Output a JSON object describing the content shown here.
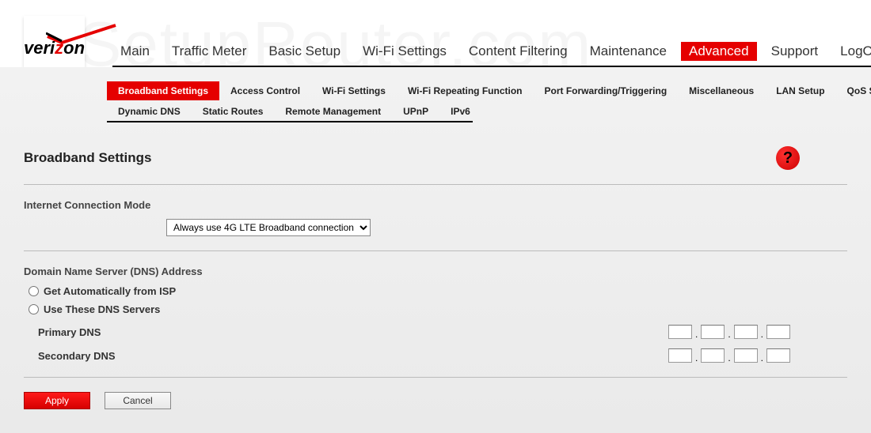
{
  "watermark": "SetupRouter.com",
  "logo": {
    "text_prefix": "veri",
    "text_accent": "z",
    "text_suffix": "on"
  },
  "top_nav": {
    "items": [
      {
        "label": "Main"
      },
      {
        "label": "Traffic Meter"
      },
      {
        "label": "Basic Setup"
      },
      {
        "label": "Wi-Fi Settings"
      },
      {
        "label": "Content Filtering"
      },
      {
        "label": "Maintenance"
      },
      {
        "label": "Advanced",
        "active": true
      },
      {
        "label": "Support"
      },
      {
        "label": "LogOut"
      }
    ]
  },
  "sub_nav": {
    "row1": [
      {
        "label": "Broadband Settings",
        "active": true
      },
      {
        "label": "Access Control"
      },
      {
        "label": "Wi-Fi Settings"
      },
      {
        "label": "Wi-Fi Repeating Function"
      },
      {
        "label": "Port Forwarding/Triggering"
      },
      {
        "label": "Miscellaneous"
      },
      {
        "label": "LAN Setup"
      },
      {
        "label": "QoS Setup"
      }
    ],
    "row2": [
      {
        "label": "Dynamic DNS"
      },
      {
        "label": "Static Routes"
      },
      {
        "label": "Remote Management"
      },
      {
        "label": "UPnP"
      },
      {
        "label": "IPv6"
      }
    ]
  },
  "page": {
    "title": "Broadband Settings",
    "help_symbol": "?"
  },
  "connection_mode": {
    "label": "Internet Connection Mode",
    "selected": "Always use 4G LTE Broadband connection"
  },
  "dns_section": {
    "heading": "Domain Name Server (DNS) Address",
    "option_auto": "Get Automatically from ISP",
    "option_manual": "Use These DNS Servers",
    "primary_label": "Primary DNS",
    "secondary_label": "Secondary DNS",
    "primary": [
      "",
      "",
      "",
      ""
    ],
    "secondary": [
      "",
      "",
      "",
      ""
    ]
  },
  "buttons": {
    "apply": "Apply",
    "cancel": "Cancel"
  }
}
